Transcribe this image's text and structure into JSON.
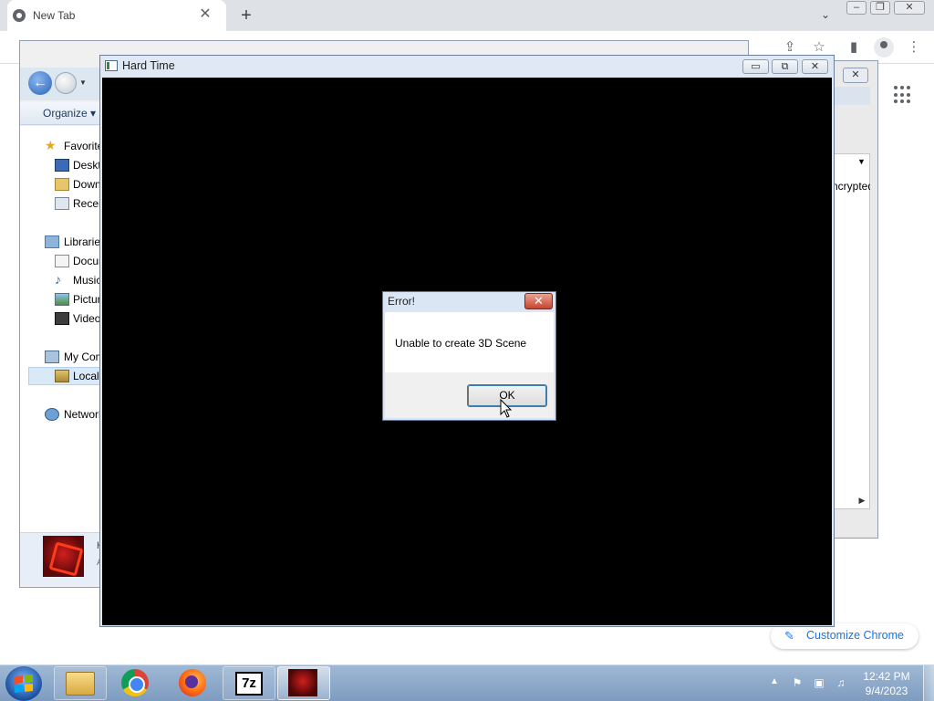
{
  "chrome": {
    "tab_title": "New Tab",
    "tab_close": "✕",
    "new_tab": "+",
    "tab_search": "⌄",
    "customize_label": "Customize Chrome",
    "customize_icon": "pencil-icon",
    "accent_color": "#1a73e8"
  },
  "explorer": {
    "organize_label": "Organize ▾",
    "tree": [
      {
        "label": "Favorites",
        "icon": "star-icon"
      },
      {
        "label": "Desktop",
        "icon": "desktop-icon"
      },
      {
        "label": "Downloads",
        "icon": "downloads-icon"
      },
      {
        "label": "Recent Places",
        "icon": "recent-places-icon"
      },
      {
        "label": "Libraries",
        "icon": "libraries-icon"
      },
      {
        "label": "Documents",
        "icon": "documents-icon"
      },
      {
        "label": "Music",
        "icon": "music-icon"
      },
      {
        "label": "Pictures",
        "icon": "pictures-icon"
      },
      {
        "label": "Videos",
        "icon": "videos-icon"
      },
      {
        "label": "My Computer",
        "icon": "computer-icon"
      },
      {
        "label": "Local Disk",
        "icon": "local-disk-icon"
      },
      {
        "label": "Network",
        "icon": "network-icon"
      }
    ],
    "details_name": "H",
    "details_sub": "A"
  },
  "bg_dialog": {
    "column_header": "Encrypted",
    "close_label": "✕"
  },
  "game_window": {
    "title": "Hard Time",
    "minimize": "▭",
    "maximize": "⧉",
    "close": "✕",
    "canvas_color": "#000000"
  },
  "error_dialog": {
    "title": "Error!",
    "close": "✕",
    "message": "Unable to create 3D Scene",
    "ok_label": "OK"
  },
  "taskbar": {
    "pinned": [
      {
        "name": "Windows Explorer",
        "icon": "explorer-icon"
      },
      {
        "name": "Google Chrome",
        "icon": "chrome-icon"
      },
      {
        "name": "Firefox",
        "icon": "firefox-icon"
      },
      {
        "name": "7-Zip",
        "icon": "7zip-icon",
        "glyph": "7z"
      },
      {
        "name": "Hard Time",
        "icon": "hard-time-icon"
      }
    ],
    "clock_time": "12:42 PM",
    "clock_date": "9/4/2023",
    "tray_expand": "▲"
  }
}
